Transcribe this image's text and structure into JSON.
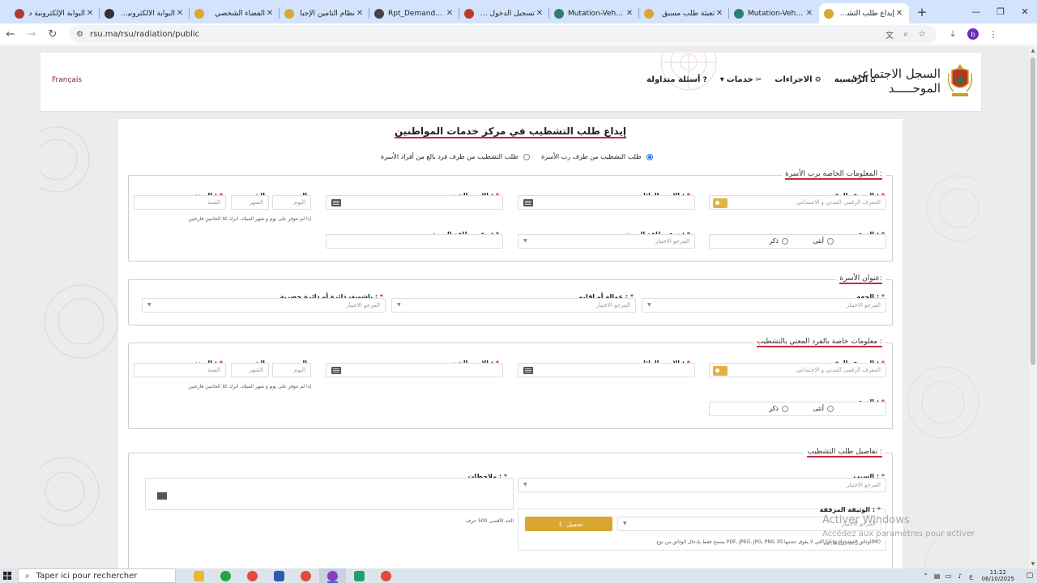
{
  "browser": {
    "tabs": [
      {
        "title": "البوابة الإلكترونية د",
        "color": "#b03a2e"
      },
      {
        "title": "البوابة الالكترونية لـ",
        "color": "#333333"
      },
      {
        "title": "الفضاء الشخصي",
        "color": "#d9a733"
      },
      {
        "title": "نظام التأمين الإجبا",
        "color": "#d9a733"
      },
      {
        "title": "Rpt_Demande_Ins",
        "color": "#444444"
      },
      {
        "title": "تسجيل الدخول | ES",
        "color": "#c0392b"
      },
      {
        "title": "Mutation-Vehicule",
        "color": "#2e7d6e"
      },
      {
        "title": "تعبئة طلب مسبق",
        "color": "#d9a733"
      },
      {
        "title": "Mutation-Vehicule",
        "color": "#2e7d6e"
      },
      {
        "title": "إيداع طلب التشطيب",
        "color": "#d9a733"
      }
    ],
    "active_tab": 9,
    "url": "rsu.ma/rsu/radiation/public"
  },
  "header": {
    "lang_link": "Français",
    "nav": [
      {
        "label": "الرئيسية",
        "icon": "home-icon"
      },
      {
        "label": "الاجراءات",
        "icon": "gear-icon"
      },
      {
        "label": "خدمات",
        "icon": "tools-icon"
      },
      {
        "label": "أسئلة متداولة",
        "icon": "question-icon"
      }
    ],
    "brand_line1": "السجل الاجتماعي",
    "brand_line2": "الموحـــــد"
  },
  "form": {
    "title": "إيداع طلب التشطيب في مركز خدمات المواطنين",
    "request_type": {
      "option1": "طلب التشطيب من طرف رب الأسرة",
      "option2": "طلب التشطيب من طرف فرد بالغ من أفراد الأسرة",
      "selected": 1
    },
    "head_section": {
      "legend": "المعلومات الخاصة برب الأسرة :",
      "id_label": "المعرف الرقمي :",
      "id_placeholder": "المعرف الرقمي المدني و الاجتماعي",
      "family_name_label": "الاسم العائلي :",
      "first_name_label": "الاسم الشخصي :",
      "day_label": "اليوم",
      "day_placeholder": "اليوم",
      "month_label": "الشهر",
      "month_placeholder": "الشهر",
      "year_label": "السنة :",
      "year_placeholder": "السنة",
      "date_hint": "إذا لم تتوفر على يوم و شهر الميلاد، اترك كلا الخانتين فارغتين",
      "gender_label": "النوع :",
      "female": "أنثى",
      "male": "ذكر",
      "id_card_type_label": "نوع بطاقة الهوية :",
      "id_card_type_placeholder": "المرجو الاختيار",
      "id_card_number_label": "رقم بطاقة الهوية :"
    },
    "address_section": {
      "legend": "عنوان الأسرة:",
      "region_label": "الجهة :",
      "region_placeholder": "المرجو الاختيار",
      "province_label": "عمالة أو إقليم :",
      "province_placeholder": "المرجو الاختيار",
      "district_label": "باشوية، دائرة أو دائرة حضرية :",
      "district_placeholder": "المرجو الاختيار"
    },
    "member_section": {
      "legend": "معلومات خاصة بالفرد المعني بالتشطيب :",
      "id_label": "المعرف الرقمي :",
      "id_placeholder": "المعرف الرقمي المدني و الاجتماعي",
      "family_name_label": "الاسم العائلي :",
      "first_name_label": "الاسم الشخصي :",
      "day_label": "اليوم",
      "day_placeholder": "اليوم",
      "month_label": "الشهر",
      "month_placeholder": "الشهر",
      "year_label": "السنة :",
      "year_placeholder": "السنة",
      "date_hint": "إذا لم تتوفر على يوم و شهر الميلاد، اترك كلا الخانتين فارغتين",
      "gender_label": "النوع :",
      "female": "أنثى",
      "male": "ذكر"
    },
    "details_section": {
      "legend": "تفاصيل طلب التشطيب :",
      "reason_label": "السبب :",
      "reason_placeholder": "المرجو الاختيار",
      "notes_label": "ملاحظات :",
      "notes_hint": "الحد الأقصى 500 حرف",
      "attachment_label": "الوثيقة المرفقة :",
      "attachment_placeholder": "المرجو الاختيار",
      "upload_button": "تحميل",
      "attachment_hint": "يسمح فقط بإدخال الوثائق من نوع PDF, JPEG, JPG, PNG الوثائق المسموح بها هي التي لا يفوق حجمها 30MO"
    }
  },
  "watermark": {
    "line1": "Activer Windows",
    "line2": "Accédez aux paramètres pour activer Windows."
  },
  "taskbar": {
    "search_placeholder": "Taper ici pour rechercher",
    "time": "11:22",
    "date": "06/10/2025",
    "lang_indicator": "ع"
  }
}
